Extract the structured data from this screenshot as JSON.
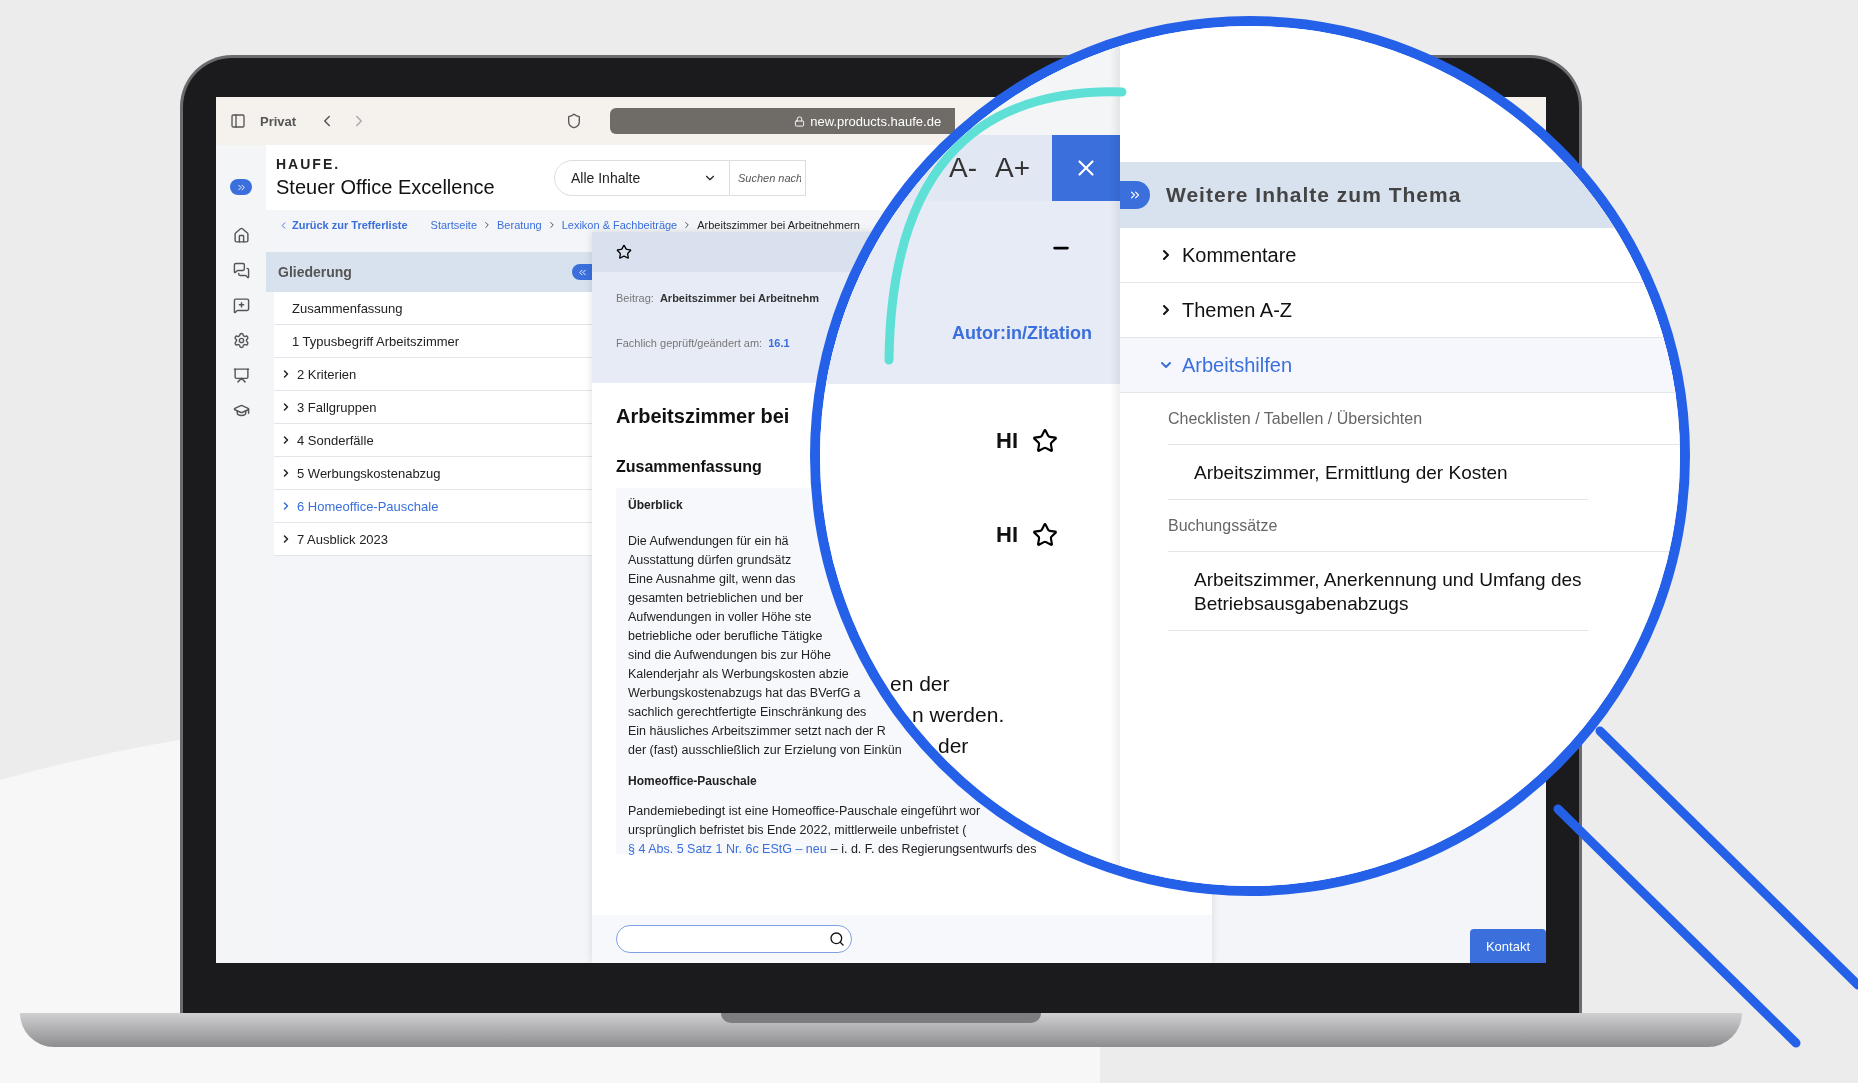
{
  "browser": {
    "profile": "Privat",
    "url": "new.products.haufe.de"
  },
  "app": {
    "brand": "HAUFE.",
    "product": "Steuer Office Excellence",
    "scope": "Alle Inhalte",
    "search_placeholder": "Suchen nach"
  },
  "breadcrumb": {
    "back": "Zurück zur Trefferliste",
    "items": [
      "Startseite",
      "Beratung",
      "Lexikon & Fachbeiträge",
      "Arbeitszimmer bei Arbeitnehmern"
    ]
  },
  "outline": {
    "title": "Gliederung",
    "items": [
      {
        "label": "Zusammenfassung",
        "expandable": false,
        "selected": false
      },
      {
        "label": "1 Typusbegriff Arbeitszimmer",
        "expandable": false,
        "selected": false
      },
      {
        "label": "2 Kriterien",
        "expandable": true,
        "selected": false
      },
      {
        "label": "3 Fallgruppen",
        "expandable": true,
        "selected": false
      },
      {
        "label": "4 Sonderfälle",
        "expandable": true,
        "selected": false
      },
      {
        "label": "5 Werbungskostenabzug",
        "expandable": true,
        "selected": false
      },
      {
        "label": "6 Homeoffice-Pauschale",
        "expandable": true,
        "selected": true
      },
      {
        "label": "7 Ausblick 2023",
        "expandable": true,
        "selected": false
      }
    ]
  },
  "article": {
    "meta_label": "Beitrag:",
    "meta_title": "Arbeitszimmer bei Arbeitnehm",
    "checked_label": "Fachlich geprüft/geändert am:",
    "checked_date": "16.1",
    "title": "Arbeitszimmer bei",
    "section": "Zusammenfassung",
    "box_title": "Überblick",
    "box_lines": [
      "Die Aufwendungen für ein hä",
      "Ausstattung dürfen grundsätz",
      "Eine Ausnahme gilt, wenn das",
      "gesamten betrieblichen und ber",
      "Aufwendungen in voller Höhe ste",
      "betriebliche oder berufliche Tätigke",
      "sind die Aufwendungen bis zur Höhe",
      "Kalenderjahr als Werbungskosten abzie",
      "Werbungskostenabzugs hat das BVerfG a",
      "sachlich gerechtfertigte Einschränkung des",
      "Ein häusliches Arbeitszimmer setzt nach der R",
      "der (fast) ausschließlich zur Erzielung von Einkün"
    ],
    "subheading": "Homeoffice-Pauschale",
    "para_lines": [
      "Pandemiebedingt ist eine Homeoffice-Pauschale eingeführt wor",
      "ursprünglich befristet bis Ende 2022, mittlerweile unbefristet ("
    ],
    "law_link": "§ 4 Abs. 5 Satz 1 Nr. 6c EStG – neu",
    "law_rest": "– i. d. F. des Regierungsentwurfs des"
  },
  "magnifier": {
    "font_smaller": "A-",
    "font_larger": "A+",
    "author_link": "Autor:in/Zitation",
    "highlights": [
      "HI",
      "HI"
    ],
    "fragments": [
      "en der",
      "n werden.",
      "der"
    ],
    "related": {
      "title": "Weitere Inhalte zum Thema",
      "items": [
        {
          "label": "Kommentare",
          "expanded": false
        },
        {
          "label": "Themen A-Z",
          "expanded": false
        },
        {
          "label": "Arbeitshilfen",
          "expanded": true,
          "children": [
            {
              "label": "Checklisten / Tabellen / Übersichten",
              "children": [
                {
                  "label": "Arbeitszimmer, Ermittlung der Kosten"
                }
              ]
            },
            {
              "label": "Buchungssätze",
              "children": [
                {
                  "label": "Arbeitszimmer, Anerkennung und Umfang des Betriebsausgabenabzugs"
                }
              ]
            }
          ]
        }
      ]
    }
  },
  "contact": "Kontakt"
}
